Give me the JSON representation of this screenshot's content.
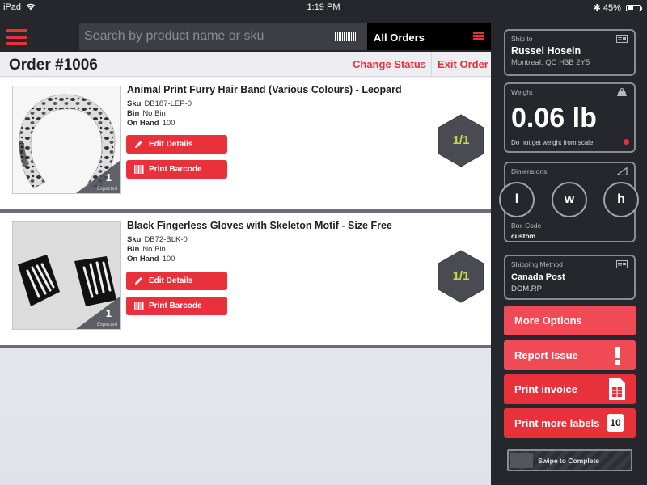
{
  "status_bar": {
    "device": "iPad",
    "time": "1:19 PM",
    "battery": "45%"
  },
  "header": {
    "search_placeholder": "Search by product name or sku",
    "filter_label": "All Orders"
  },
  "order": {
    "title": "Order #1006",
    "change_status_label": "Change Status",
    "exit_label": "Exit Order"
  },
  "labels": {
    "sku": "Sku",
    "bin": "Bin",
    "on_hand": "On Hand",
    "edit_details": "Edit Details",
    "print_barcode": "Print Barcode",
    "expected": "Expected"
  },
  "items": [
    {
      "name": "Animal Print Furry Hair Band (Various Colours) - Leopard",
      "sku": "DB187-LEP-0",
      "bin": "No Bin",
      "on_hand": "100",
      "expected": "1",
      "picked": "1/1",
      "image": "leopard-headband"
    },
    {
      "name": "Black Fingerless Gloves with Skeleton Motif - Size Free",
      "sku": "DB72-BLK-0",
      "bin": "No Bin",
      "on_hand": "100",
      "expected": "1",
      "picked": "1/1",
      "image": "skeleton-gloves"
    }
  ],
  "panel": {
    "ship_to": {
      "label": "Ship to",
      "name": "Russel Hosein",
      "address": "Montreal, QC H3B 2Y5"
    },
    "weight": {
      "label": "Weight",
      "value": "0.06 lb",
      "note": "Do not get weight from scale"
    },
    "dimensions": {
      "label": "Dimensions",
      "l": "l",
      "w": "w",
      "h": "h",
      "box_code_label": "Box Code",
      "box_code": "custom"
    },
    "shipping_method": {
      "label": "Shipping Method",
      "carrier": "Canada Post",
      "code": "DOM.RP"
    },
    "actions": {
      "more_options": "More Options",
      "report_issue": "Report Issue",
      "print_invoice": "Print invoice",
      "print_labels": "Print more labels",
      "labels_count": "10"
    },
    "swipe_label": "Swipe to Complete"
  },
  "colors": {
    "accent": "#e8313b",
    "panel_bg": "#26272c",
    "hex_text": "#c8d84a"
  }
}
